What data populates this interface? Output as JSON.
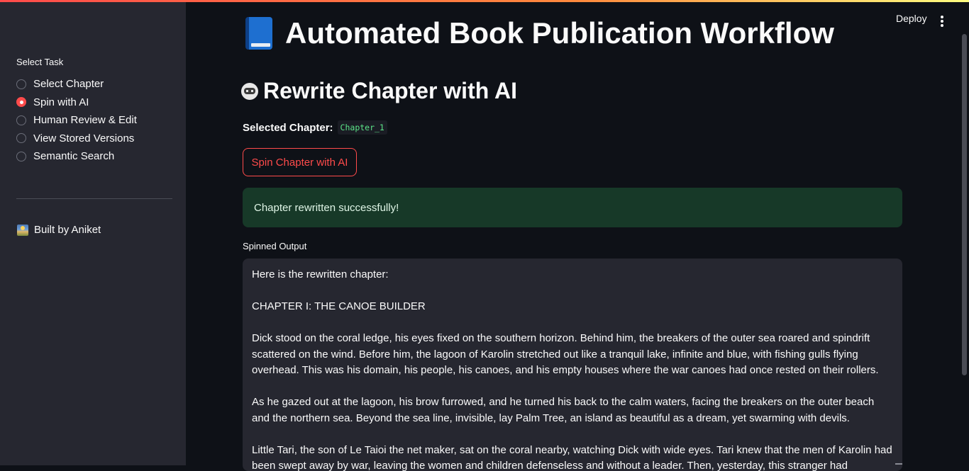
{
  "sidebar": {
    "task_label": "Select Task",
    "tasks": [
      {
        "label": "Select Chapter",
        "checked": false
      },
      {
        "label": "Spin with AI",
        "checked": true
      },
      {
        "label": "Human Review & Edit",
        "checked": false
      },
      {
        "label": "View Stored Versions",
        "checked": false
      },
      {
        "label": "Semantic Search",
        "checked": false
      }
    ],
    "built_by": "Built by Aniket",
    "built_by_icon": "sunrise-icon"
  },
  "header": {
    "deploy_label": "Deploy",
    "menu_icon": "more-vertical-icon"
  },
  "main": {
    "title": "Automated Book Publication Workflow",
    "title_icon": "blue-book-icon",
    "section_title": "Rewrite Chapter with AI",
    "section_icon": "robot-icon",
    "selected_chapter_label": "Selected Chapter:",
    "selected_chapter_value": "Chapter_1",
    "spin_button_label": "Spin Chapter with AI",
    "success_message": "Chapter rewritten successfully!",
    "output_label": "Spinned Output",
    "output_paragraphs": [
      "Here is the rewritten chapter:",
      "CHAPTER I: THE CANOE BUILDER",
      "Dick stood on the coral ledge, his eyes fixed on the southern horizon. Behind him, the breakers of the outer sea roared and spindrift scattered on the wind. Before him, the lagoon of Karolin stretched out like a tranquil lake, infinite and blue, with fishing gulls flying overhead. This was his domain, his people, his canoes, and his empty houses where the war canoes had once rested on their rollers.",
      "As he gazed out at the lagoon, his brow furrowed, and he turned his back to the calm waters, facing the breakers on the outer beach and the northern sea. Beyond the sea line, invisible, lay Palm Tree, an island as beautiful as a dream, yet swarming with devils.",
      "Little Tari, the son of Le Taioi the net maker, sat on the coral nearby, watching Dick with wide eyes. Tari knew that the men of Karolin had been swept away by war, leaving the women and children defenseless and without a leader. Then, yesterday, this stranger had"
    ]
  },
  "colors": {
    "accent": "#ff4b4b",
    "success_bg": "#173928",
    "code_green": "#5ce488",
    "sidebar_bg": "#262730",
    "app_bg": "#0e1117"
  }
}
